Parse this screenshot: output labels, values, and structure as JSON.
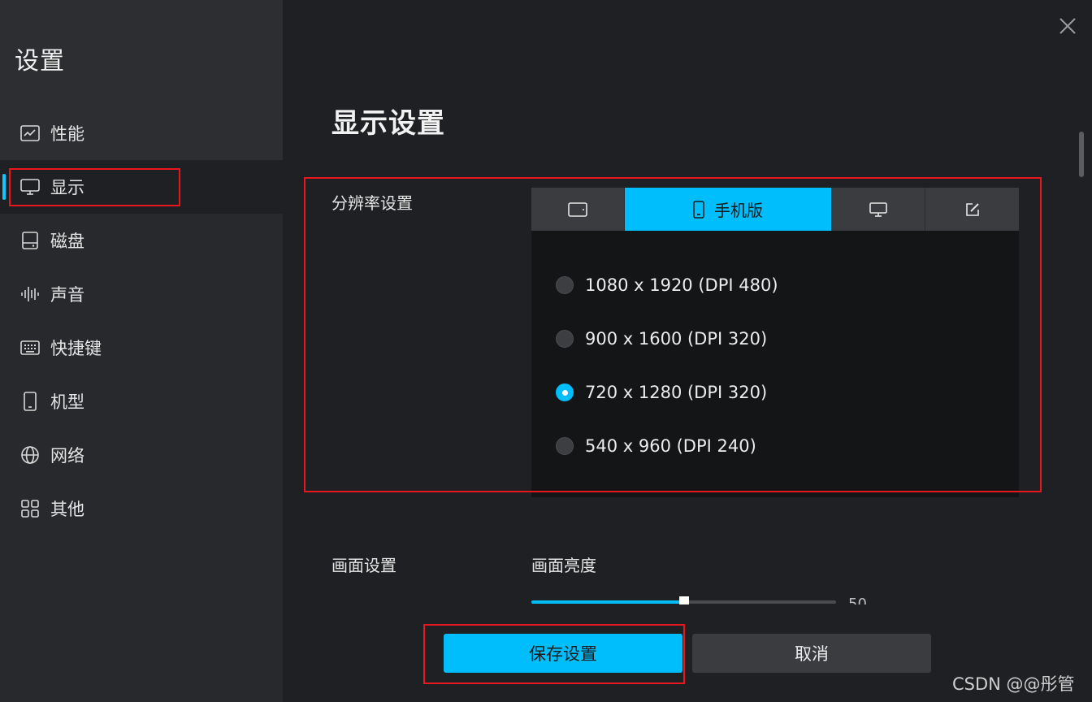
{
  "sidebar": {
    "title": "设置",
    "items": [
      {
        "label": "性能",
        "icon": "performance-chart-icon"
      },
      {
        "label": "显示",
        "icon": "monitor-icon",
        "active": true
      },
      {
        "label": "磁盘",
        "icon": "disk-icon"
      },
      {
        "label": "声音",
        "icon": "sound-wave-icon"
      },
      {
        "label": "快捷键",
        "icon": "keyboard-icon"
      },
      {
        "label": "机型",
        "icon": "phone-icon"
      },
      {
        "label": "网络",
        "icon": "globe-icon"
      },
      {
        "label": "其他",
        "icon": "grid-icon"
      }
    ]
  },
  "main": {
    "title": "显示设置",
    "resolution": {
      "label": "分辨率设置",
      "tabs": [
        {
          "label": "",
          "icon": "tablet-icon"
        },
        {
          "label": "手机版",
          "icon": "phone-icon",
          "active": true
        },
        {
          "label": "",
          "icon": "desktop-icon"
        },
        {
          "label": "",
          "icon": "edit-icon"
        }
      ],
      "options": [
        {
          "label": "1080 x 1920 (DPI 480)",
          "checked": false
        },
        {
          "label": "900 x 1600 (DPI 320)",
          "checked": false
        },
        {
          "label": "720 x 1280 (DPI 320)",
          "checked": true
        },
        {
          "label": "540 x 960 (DPI 240)",
          "checked": false
        }
      ]
    },
    "picture": {
      "label": "画面设置",
      "brightness_label": "画面亮度",
      "brightness_value": "50",
      "brightness_fraction": 0.5
    }
  },
  "footer": {
    "save_label": "保存设置",
    "cancel_label": "取消"
  },
  "watermark": "CSDN @@彤管",
  "colors": {
    "accent": "#00bdfc",
    "annotation": "#e8161d",
    "background": "#1f2023",
    "sidebar": "#27292d"
  }
}
